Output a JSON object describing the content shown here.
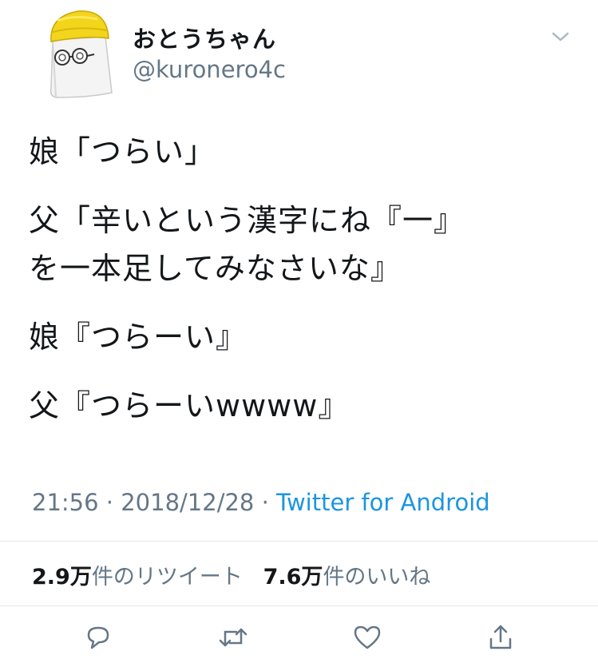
{
  "user": {
    "display_name": "おとうちゃん",
    "handle": "@kuronero4c"
  },
  "tweet": {
    "lines": [
      "娘「つらい」",
      "父「辛いという漢字にね『一』",
      "を一本足してみなさいな』",
      "娘『つらーい』",
      "父『つらーいwwww』"
    ]
  },
  "meta": {
    "time": "21:56",
    "separator": "·",
    "date": "2018/12/28",
    "source": "Twitter for Android"
  },
  "stats": {
    "retweets_count": "2.9万",
    "retweets_label": "件のリツイート",
    "likes_count": "7.6万",
    "likes_label": "件のいいね"
  },
  "icons": {
    "menu": "chevron-down-icon",
    "reply": "reply-icon",
    "retweet": "retweet-icon",
    "like": "heart-icon",
    "share": "share-icon"
  },
  "colors": {
    "link": "#1b95e0",
    "secondary": "#657786",
    "text": "#14171a",
    "divider": "#e1e8ed"
  }
}
